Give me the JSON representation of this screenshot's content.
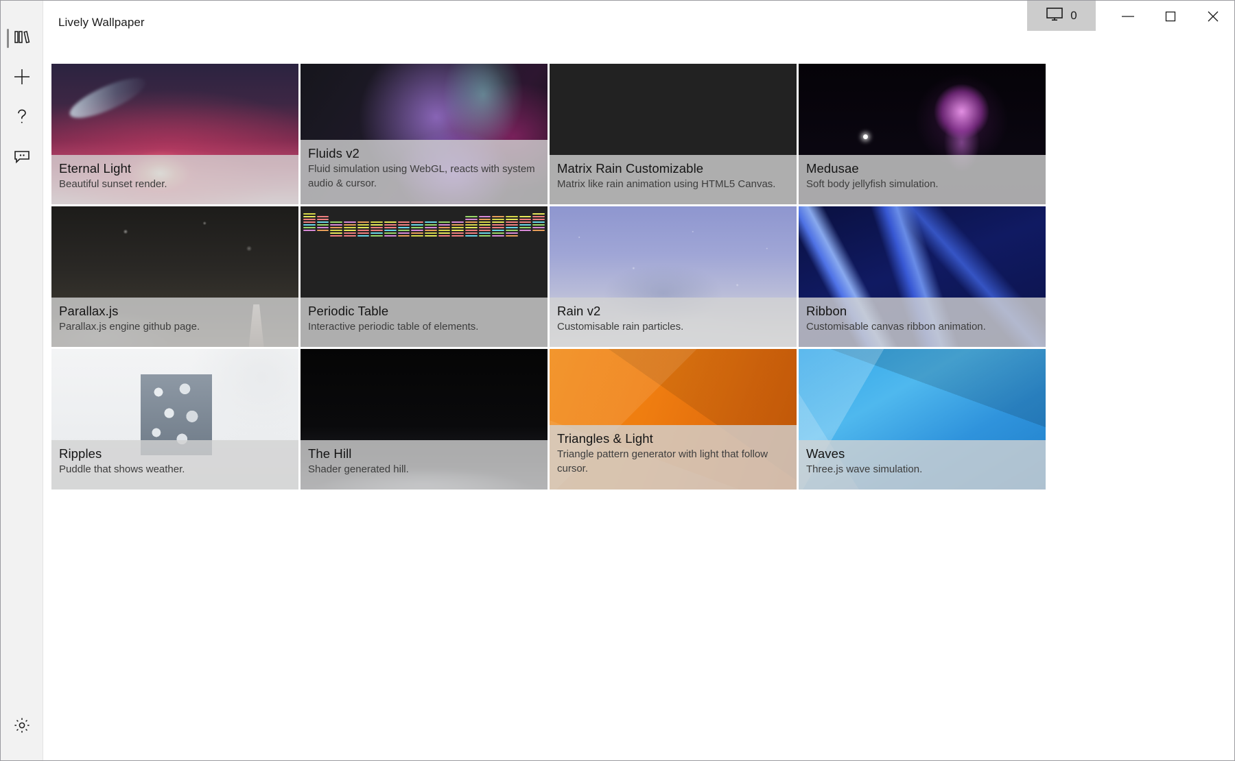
{
  "window": {
    "title": "Lively Wallpaper",
    "screen_count": "0",
    "screen_icon": "monitor-icon",
    "controls": {
      "minimize": "─",
      "maximize": "□",
      "close": "✕"
    }
  },
  "sidebar": {
    "items": [
      {
        "name": "library",
        "icon": "library-books-icon",
        "selected": true
      },
      {
        "name": "add-wallpaper",
        "icon": "plus-icon",
        "selected": false
      },
      {
        "name": "help",
        "icon": "question-mark-icon",
        "selected": false
      },
      {
        "name": "feedback",
        "icon": "feedback-chat-icon",
        "selected": false
      }
    ],
    "bottom": {
      "name": "settings",
      "icon": "gear-icon"
    }
  },
  "library": {
    "wallpapers": [
      {
        "title": "Eternal Light",
        "description": "Beautiful sunset render.",
        "art": "th-eternal"
      },
      {
        "title": "Fluids v2",
        "description": "Fluid simulation using WebGL, reacts with system audio & cursor.",
        "art": "th-fluids"
      },
      {
        "title": "Matrix Rain Customizable",
        "description": "Matrix like rain animation using HTML5 Canvas.",
        "art": "th-matrix"
      },
      {
        "title": "Medusae",
        "description": "Soft body jellyfish simulation.",
        "art": "th-medusae"
      },
      {
        "title": "Parallax.js",
        "description": "Parallax.js engine github page.",
        "art": "th-parallax"
      },
      {
        "title": "Periodic Table",
        "description": "Interactive periodic table of elements.",
        "art": "th-periodic"
      },
      {
        "title": "Rain v2",
        "description": "Customisable rain particles.",
        "art": "th-rainv2"
      },
      {
        "title": "Ribbon",
        "description": "Customisable canvas ribbon animation.",
        "art": "th-ribbon"
      },
      {
        "title": "Ripples",
        "description": "Puddle that shows weather.",
        "art": "th-ripples"
      },
      {
        "title": "The Hill",
        "description": "Shader generated hill.",
        "art": "th-hill"
      },
      {
        "title": "Triangles & Light",
        "description": "Triangle pattern generator with light that follow cursor.",
        "art": "th-triangles"
      },
      {
        "title": "Waves",
        "description": "Three.js wave simulation.",
        "art": "th-waves"
      }
    ]
  },
  "colors": {
    "rail_background": "#f2f2f2",
    "caption_overlay": "rgba(210,210,210,0.80)",
    "screen_count_chip": "#cccccc",
    "text_primary": "#141414",
    "text_secondary": "#3d3d3d"
  }
}
